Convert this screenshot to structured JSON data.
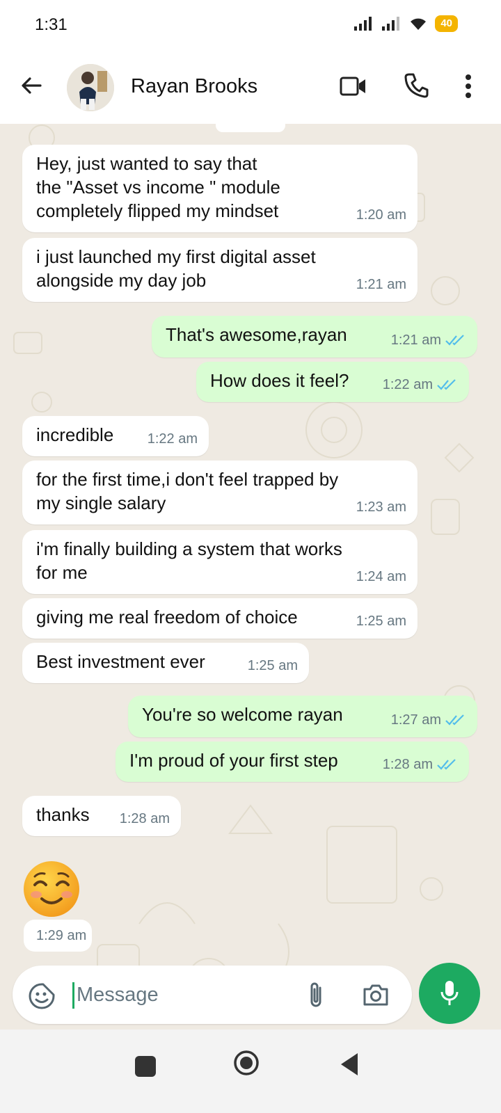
{
  "status_bar": {
    "time": "1:31",
    "battery": "40"
  },
  "header": {
    "contact_name": "Rayan Brooks",
    "icons": [
      "back-arrow-icon",
      "video-call-icon",
      "voice-call-icon",
      "more-options-icon"
    ]
  },
  "messages": [
    {
      "direction": "in",
      "text": "Hey, just wanted to say that\nthe \"Asset vs income \" module\ncompletely flipped my mindset",
      "time": "1:20 am"
    },
    {
      "direction": "in",
      "text": "i just launched my first digital asset\nalongside my day job",
      "time": "1:21 am"
    },
    {
      "direction": "out",
      "text": "That's awesome,rayan",
      "time": "1:21 am",
      "status": "read"
    },
    {
      "direction": "out",
      "text": "How does it feel?",
      "time": "1:22 am",
      "status": "read"
    },
    {
      "direction": "in",
      "text": "incredible",
      "time": "1:22 am"
    },
    {
      "direction": "in",
      "text": "for the first time,i don't feel trapped by\nmy single salary",
      "time": "1:23 am"
    },
    {
      "direction": "in",
      "text": "i'm finally building a system that works\nfor me",
      "time": "1:24 am"
    },
    {
      "direction": "in",
      "text": "giving me real freedom of choice",
      "time": "1:25 am"
    },
    {
      "direction": "in",
      "text": "Best investment ever",
      "time": "1:25 am"
    },
    {
      "direction": "out",
      "text": "You're so welcome rayan",
      "time": "1:27 am",
      "status": "read"
    },
    {
      "direction": "out",
      "text": "I'm proud of your first step",
      "time": "1:28 am",
      "status": "read"
    },
    {
      "direction": "in",
      "text": "thanks",
      "time": "1:28 am"
    }
  ],
  "sticker": {
    "emoji": "smiling-face-with-smiling-eyes",
    "time": "1:29 am"
  },
  "composer": {
    "placeholder": "Message",
    "icons": [
      "sticker-icon",
      "attach-icon",
      "camera-icon",
      "mic-icon"
    ]
  },
  "colors": {
    "accent": "#1daa61",
    "outgoing_bubble": "#d9fdd3",
    "incoming_bubble": "#ffffff",
    "chat_background": "#efeae2",
    "read_ticks": "#53bdeb"
  }
}
